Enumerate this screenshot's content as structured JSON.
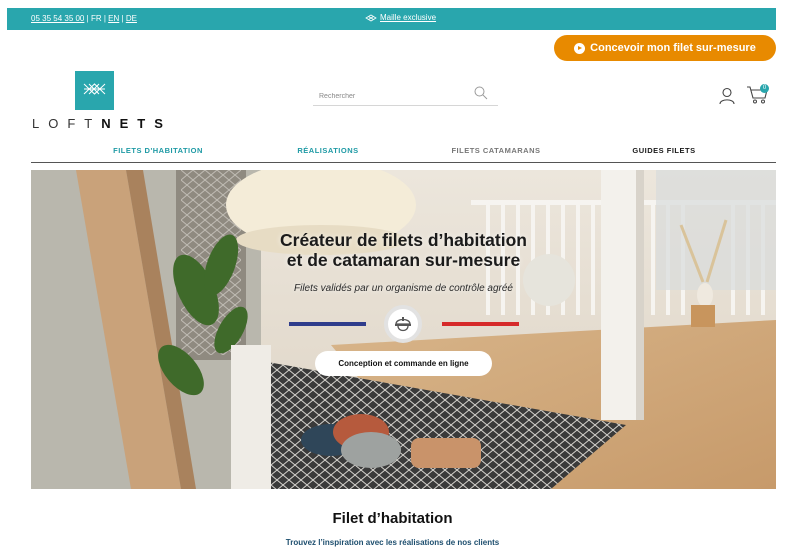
{
  "topbar": {
    "phone": "05 35 54 35 00",
    "lang_fr": "FR",
    "lang_en": "EN",
    "lang_de": "DE",
    "sep": "|",
    "promo_label": "Maille exclusive",
    "bg_color": "#29a6ad"
  },
  "cta": {
    "label": "Concevoir mon filet sur-mesure",
    "color": "#e88a00"
  },
  "logo": {
    "part1": "LOFT",
    "part2": "NETS"
  },
  "search": {
    "placeholder": "Rechercher"
  },
  "cart": {
    "count": "0"
  },
  "nav": [
    {
      "label": "FILETS D'HABITATION",
      "color": "#1f9aa5"
    },
    {
      "label": "RÉALISATIONS",
      "color": "#1f9aa5"
    },
    {
      "label": "FILETS CATAMARANS",
      "color": "#777777"
    },
    {
      "label": "GUIDES FILETS",
      "color": "#1a1a1a"
    }
  ],
  "hero": {
    "title_line1": "Créateur de filets d’habitation",
    "title_line2": "et de catamaran sur-mesure",
    "subtitle": "Filets validés par un organisme de contrôle agréé",
    "badge": "Conception et commande en ligne"
  },
  "section": {
    "title": "Filet d’habitation",
    "subtitle": "Trouvez l’inspiration avec les réalisations de nos clients"
  }
}
